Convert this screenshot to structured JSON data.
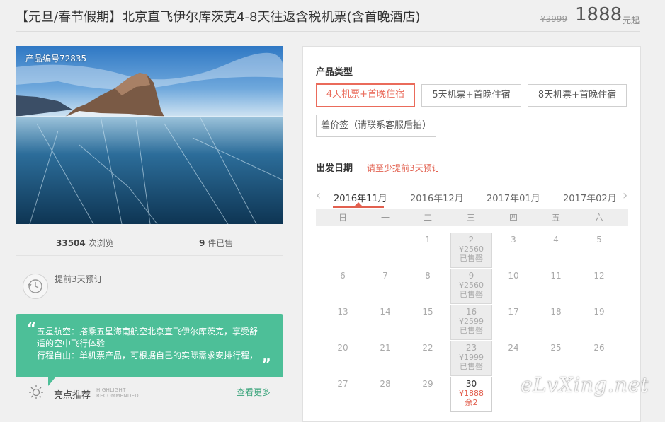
{
  "product": {
    "title": "【元旦/春节假期】北京直飞伊尔库茨克4-8天往返含税机票(含首晚酒店)",
    "old_price": "¥3999",
    "price": "1888",
    "price_unit": "元起"
  },
  "photo": {
    "product_id": "产品编号72835"
  },
  "stats": {
    "views": "33504",
    "views_label": "次浏览",
    "sold": "9",
    "sold_label": "件已售"
  },
  "advance": {
    "text": "提前3天预订"
  },
  "highlight": {
    "line1": "五星航空：搭乘五星海南航空北京直飞伊尔库茨克，享受舒适的空中飞行体验",
    "line2": "行程自由：单机票产品，可根据自己的实际需求安排行程，",
    "title": "亮点推荐",
    "en_line1": "HIGHLIGHT",
    "en_line2": "RECOMMENDED",
    "more": "查看更多",
    "quote_open": "“",
    "quote_close": "„"
  },
  "booking": {
    "type_title": "产品类型",
    "options": [
      {
        "label": "4天机票+首晚住宿",
        "selected": true
      },
      {
        "label": "5天机票+首晚住宿",
        "selected": false
      },
      {
        "label": "8天机票+首晚住宿",
        "selected": false
      },
      {
        "label": "差价签（请联系客服后拍）",
        "selected": false
      }
    ],
    "date_title": "出发日期",
    "date_hint": "请至少提前3天预订",
    "months": [
      "2016年11月",
      "2016年12月",
      "2017年01月",
      "2017年02月"
    ],
    "selected_month": "2016年11月",
    "prev_icon": "‹",
    "next_icon": "›",
    "weekdays": [
      "日",
      "一",
      "二",
      "三",
      "四",
      "五",
      "六"
    ],
    "weeks": [
      [
        "",
        "",
        "1",
        "2",
        "3",
        "4",
        "5"
      ],
      [
        "6",
        "7",
        "8",
        "9",
        "10",
        "11",
        "12"
      ],
      [
        "13",
        "14",
        "15",
        "16",
        "17",
        "18",
        "19"
      ],
      [
        "20",
        "21",
        "22",
        "23",
        "24",
        "25",
        "26"
      ],
      [
        "27",
        "28",
        "29",
        "30",
        "",
        "",
        ""
      ]
    ],
    "priced_days": {
      "2": {
        "price": "¥2560",
        "status": "已售罄",
        "state": "past"
      },
      "9": {
        "price": "¥2560",
        "status": "已售罄",
        "state": "past"
      },
      "16": {
        "price": "¥2599",
        "status": "已售罄",
        "state": "past"
      },
      "23": {
        "price": "¥1999",
        "status": "已售罄",
        "state": "past"
      },
      "30": {
        "price": "¥1888",
        "status": "余2",
        "state": "avail"
      }
    }
  },
  "watermark": "eLvXing.net",
  "colors": {
    "accent": "#ea6b5b",
    "green": "#4dbf98",
    "hint": "#e2604f"
  }
}
